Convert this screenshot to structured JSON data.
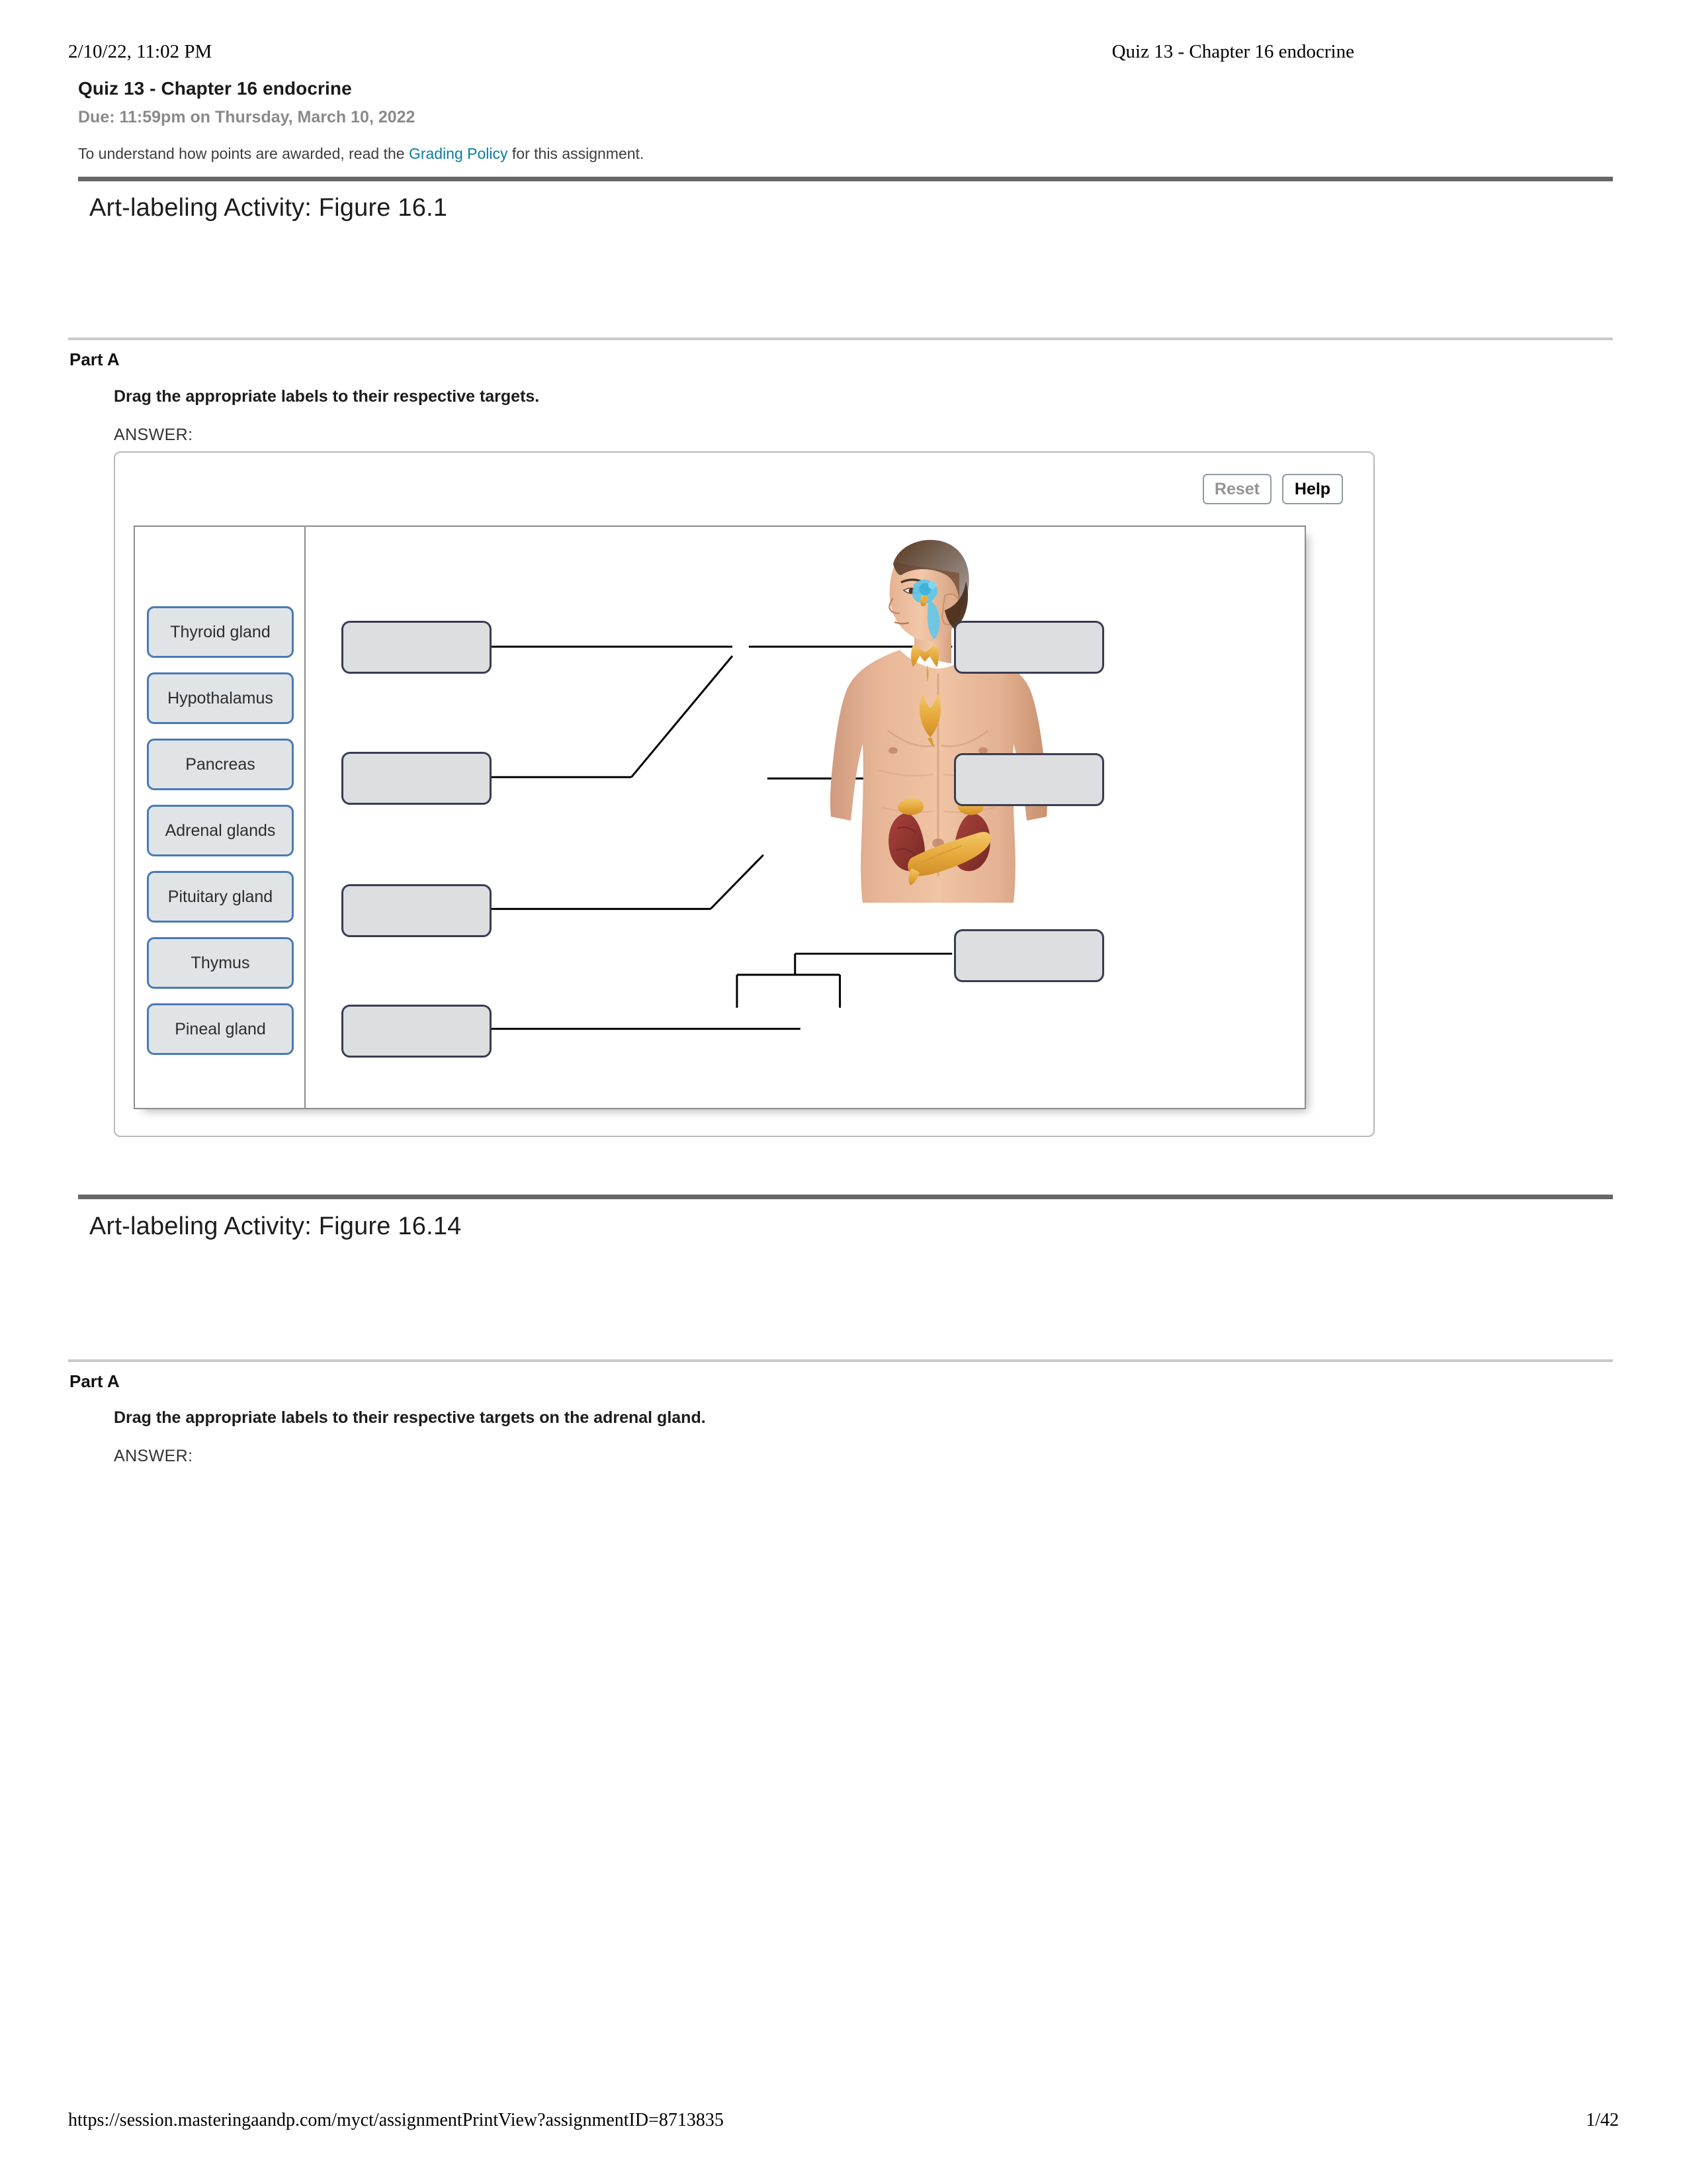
{
  "print_header": {
    "datetime": "2/10/22, 11:02 PM",
    "doc_title": "Quiz 13 - Chapter 16 endocrine"
  },
  "print_footer": {
    "url": "https://session.masteringaandp.com/myct/assignmentPrintView?assignmentID=8713835",
    "page": "1/42"
  },
  "assignment": {
    "title": "Quiz 13 - Chapter 16 endocrine",
    "due": "Due: 11:59pm on Thursday, March 10, 2022",
    "note_before": "To understand how points are awarded, read the ",
    "note_link": "Grading Policy",
    "note_after": " for this assignment."
  },
  "activities": [
    {
      "title": "Art-labeling Activity: Figure 16.1",
      "part_label": "Part A",
      "prompt": "Drag the appropriate labels to their respective targets.",
      "answer_label": "ANSWER:",
      "toolbar": {
        "reset_label": "Reset",
        "help_label": "Help"
      },
      "bank_labels": [
        "Thyroid gland",
        "Hypothalamus",
        "Pancreas",
        "Adrenal glands",
        "Pituitary gland",
        "Thymus",
        "Pineal gland"
      ],
      "targets_left": [
        "",
        "",
        "",
        ""
      ],
      "targets_right": [
        "",
        "",
        ""
      ],
      "figure_alt": "Anterior view of a male torso with endocrine glands highlighted: pineal and pituitary in the head, thyroid in the neck, thymus in the chest, adrenal glands atop the kidneys, and the pancreas in the abdomen."
    },
    {
      "title": "Art-labeling Activity: Figure 16.14",
      "part_label": "Part A",
      "prompt": "Drag the appropriate labels to their respective targets on the adrenal gland.",
      "answer_label": "ANSWER:"
    }
  ],
  "colors": {
    "link": "#0b7d9e",
    "rule_thick": "#676767",
    "rule_thin": "#c9c9c9",
    "chip_border": "#4a7ab5",
    "chip_fill": "#e1e4e6",
    "target_border": "#3a3c52",
    "target_fill": "#dcdee0",
    "gland_gold": "#e8a93c",
    "gland_blue": "#5fc6e8",
    "kidney_red": "#9e3b35"
  }
}
